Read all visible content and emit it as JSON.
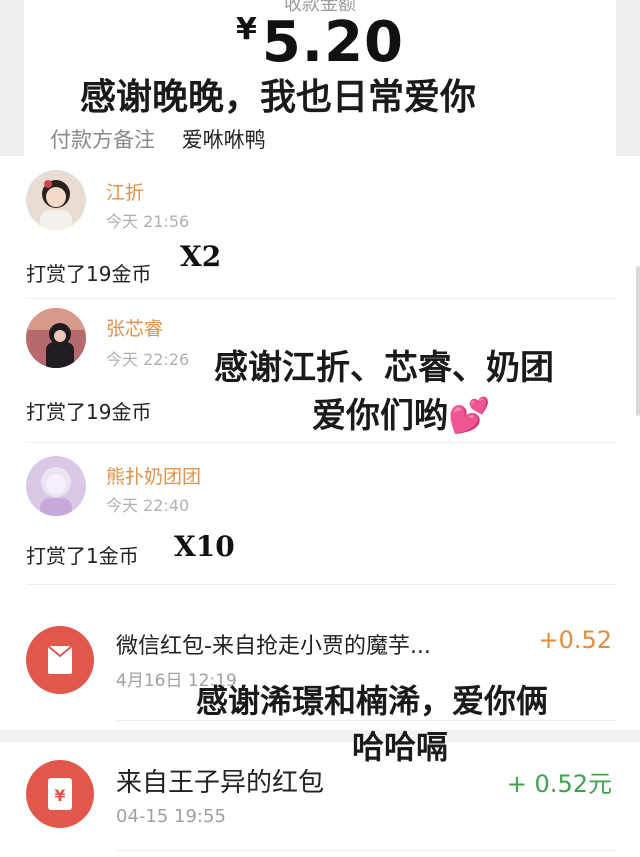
{
  "receipt": {
    "label": "收款金额",
    "currency": "¥",
    "amount": "5.20",
    "remark_key": "付款方备注",
    "remark_value": "爱咻咻鸭"
  },
  "tips": [
    {
      "name": "江折",
      "time": "今天 21:56",
      "text": "打赏了19金币",
      "multiplier": "X2"
    },
    {
      "name": "张芯睿",
      "time": "今天 22:26",
      "text": "打赏了19金币",
      "multiplier": ""
    },
    {
      "name": "熊扑奶团团",
      "time": "今天 22:40",
      "text": "打赏了1金币",
      "multiplier": "X10"
    }
  ],
  "wallet": [
    {
      "title": "微信红包-来自抢走小贾的魔芋...",
      "date": "4月16日 12:19",
      "amount": "+0.52",
      "amount_color": "#e58b3a"
    },
    {
      "title": "来自王子异的红包",
      "date": "04-15 19:55",
      "amount": "+ 0.52元",
      "amount_color": "#3ea24c"
    }
  ],
  "captions": {
    "c1": "感谢晚晚，我也日常爱你",
    "c2_line1": "感谢江折、芯睿、奶团",
    "c2_line2": "爱你们哟",
    "c2_emoji": "💕",
    "c3_line1": "感谢浠璟和楠浠，爱你俩",
    "c3_line2": "哈哈嗝"
  },
  "colors": {
    "name_orange": "#e0924b",
    "red_icon": "#e2574c"
  }
}
